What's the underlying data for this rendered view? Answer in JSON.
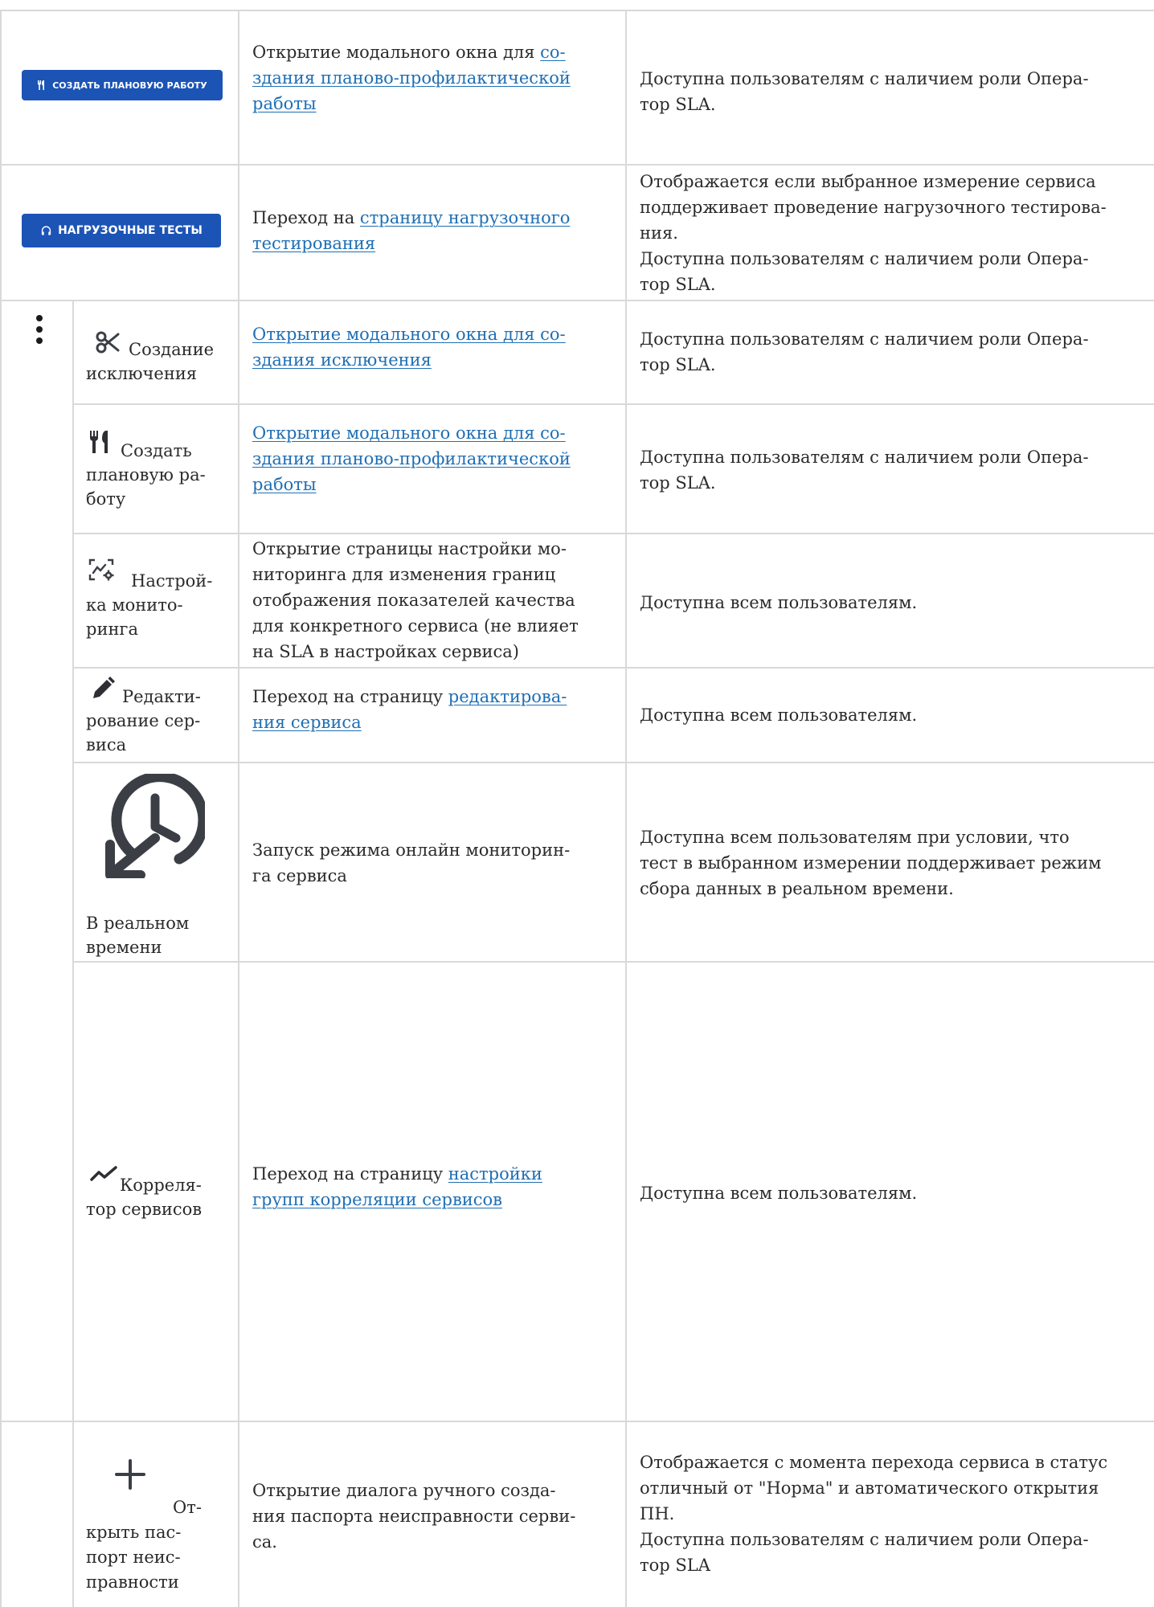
{
  "buttons": {
    "create_planned_work": "СОЗДАТЬ ПЛАНОВУЮ РАБОТУ",
    "load_tests": "НАГРУЗОЧНЫЕ ТЕСТЫ"
  },
  "rows": [
    {
      "desc_pre": "Открытие модального окна для ",
      "desc_link": [
        "со-",
        "здания планово-профилактической",
        "работы"
      ],
      "availability": [
        "Доступна пользователям с наличием роли Опера-",
        "тор SLA."
      ]
    },
    {
      "desc_pre": "Переход на ",
      "desc_link": [
        "страницу нагрузочного",
        "тестирования"
      ],
      "availability": [
        "Отображается если выбранное измерение сервиса",
        "поддерживает проведение нагрузочного тестирова-",
        "ния.",
        "Доступна пользователям с наличием роли Опера-",
        "тор SLA."
      ]
    },
    {
      "label": [
        "Создание",
        "исключения"
      ],
      "desc_link": [
        "Открытие модального окна для со-",
        "здания исключения"
      ],
      "availability": [
        "Доступна пользователям с наличием роли Опера-",
        "тор SLA."
      ]
    },
    {
      "label": [
        "Создать",
        "плановую ра-",
        "боту"
      ],
      "desc_link": [
        "Открытие модального окна для со-",
        "здания планово-профилактической",
        "работы"
      ],
      "availability": [
        "Доступна пользователям с наличием роли Опера-",
        "тор SLA."
      ]
    },
    {
      "label": [
        "Настрой-",
        "ка монито-",
        "ринга"
      ],
      "desc": [
        "Открытие страницы настройки мо-",
        "ниторинга для изменения границ",
        "отображения показателей качества",
        "для конкретного сервиса (не влияет",
        "на SLA в настройках сервиса)"
      ],
      "availability": [
        "Доступна всем пользователям."
      ]
    },
    {
      "label": [
        "Редакти-",
        "рование сер-",
        "виса"
      ],
      "desc_pre": "Переход на страницу ",
      "desc_link": [
        "редактирова-",
        "ния сервиса"
      ],
      "availability": [
        "Доступна всем пользователям."
      ]
    },
    {
      "label": [
        "В реальном",
        "времени"
      ],
      "desc": [
        "Запуск режима онлайн мониторин-",
        "га сервиса"
      ],
      "availability": [
        "Доступна всем пользователям при условии, что",
        "тест в выбранном измерении поддерживает режим",
        "сбора данных в реальном времени."
      ]
    },
    {
      "label": [
        "Корреля-",
        "тор сервисов"
      ],
      "desc_pre": "Переход на страницу ",
      "desc_link": [
        "настройки",
        "групп корреляции сервисов"
      ],
      "availability": [
        "Доступна всем пользователям."
      ]
    },
    {
      "label": [
        "От-",
        "крыть пас-",
        "порт неис-",
        "правности"
      ],
      "desc": [
        "Открытие диалога ручного созда-",
        "ния паспорта неисправности серви-",
        "са."
      ],
      "availability": [
        "Отображается с момента перехода сервиса в статус",
        "отличный от \"Норма\" и автоматического открытия",
        "ПН.",
        "Доступна пользователям с наличием роли Опера-",
        "тор SLA"
      ]
    }
  ]
}
